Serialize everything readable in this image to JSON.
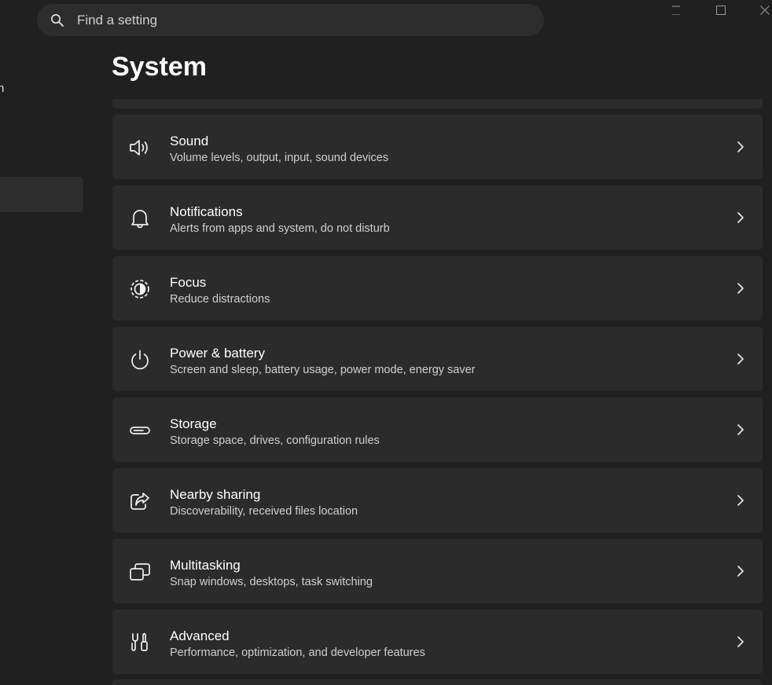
{
  "search": {
    "placeholder": "Find a setting"
  },
  "nav": {
    "fragment_text": "n"
  },
  "page": {
    "title": "System"
  },
  "settings": [
    {
      "title": "Sound",
      "description": "Volume levels, output, input, sound devices",
      "icon": "speaker-icon"
    },
    {
      "title": "Notifications",
      "description": "Alerts from apps and system, do not disturb",
      "icon": "bell-icon"
    },
    {
      "title": "Focus",
      "description": "Reduce distractions",
      "icon": "focus-icon"
    },
    {
      "title": "Power & battery",
      "description": "Screen and sleep, battery usage, power mode, energy saver",
      "icon": "power-icon"
    },
    {
      "title": "Storage",
      "description": "Storage space, drives, configuration rules",
      "icon": "storage-icon"
    },
    {
      "title": "Nearby sharing",
      "description": "Discoverability, received files location",
      "icon": "share-icon"
    },
    {
      "title": "Multitasking",
      "description": "Snap windows, desktops, task switching",
      "icon": "multitasking-icon"
    },
    {
      "title": "Advanced",
      "description": "Performance, optimization, and developer features",
      "icon": "tools-icon"
    }
  ],
  "colors": {
    "window_bg": "#202020",
    "card_bg": "#2b2b2b",
    "search_bg": "#2d2d2d",
    "text_primary": "#ffffff",
    "text_secondary": "#cfcfcf"
  }
}
